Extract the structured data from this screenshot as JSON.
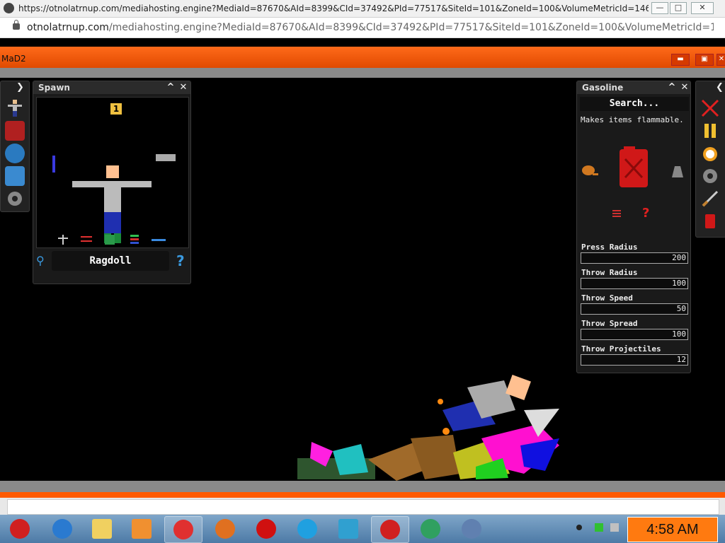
{
  "browser": {
    "title": "https://otnolatrnup.com/mediahosting.engine?MediaId=87670&AId=8399&CId=37492&PId=77517&SiteId=101&ZoneId=100&VolumeMetricId=14699881-d2c2-469...",
    "url_host": "otnolatrnup.com",
    "url_path": "/mediahosting.engine?MediaId=87670&AId=8399&CId=37492&PId=77517&SiteId=101&ZoneId=100&VolumeMetricId=14699881-d2c...",
    "minimize": "—",
    "maximize": "□",
    "close": "✕"
  },
  "app": {
    "name": "MaD2"
  },
  "spawn_panel": {
    "title": "Spawn",
    "level_badge": "1",
    "selected_item": "Ragdoll",
    "help_glyph": "?"
  },
  "item_panel": {
    "title": "Gasoline",
    "search_placeholder": "Search...",
    "description": "Makes items flammable.",
    "help_glyph": "?",
    "sliders": [
      {
        "label": "Press Radius",
        "value": "200",
        "fill": 1.0
      },
      {
        "label": "Throw Radius",
        "value": "100",
        "fill": 1.0
      },
      {
        "label": "Throw Speed",
        "value": "50",
        "fill": 1.0
      },
      {
        "label": "Throw Spread",
        "value": "100",
        "fill": 1.0
      },
      {
        "label": "Throw Projectiles",
        "value": "12",
        "fill": 1.0
      }
    ]
  },
  "taskbar": {
    "clock": "4:58 AM",
    "apps": [
      "angry-birds-icon",
      "internet-explorer-icon",
      "folder-icon",
      "media-player-icon",
      "chrome-icon",
      "firefox-icon",
      "opera-icon",
      "skype-icon",
      "box-icon",
      "angry-birds-icon",
      "network-icon",
      "game-icon"
    ]
  },
  "colors": {
    "accent": "#ff6a1a",
    "panel": "#1a1a1a",
    "gasoline": "#d01818"
  }
}
